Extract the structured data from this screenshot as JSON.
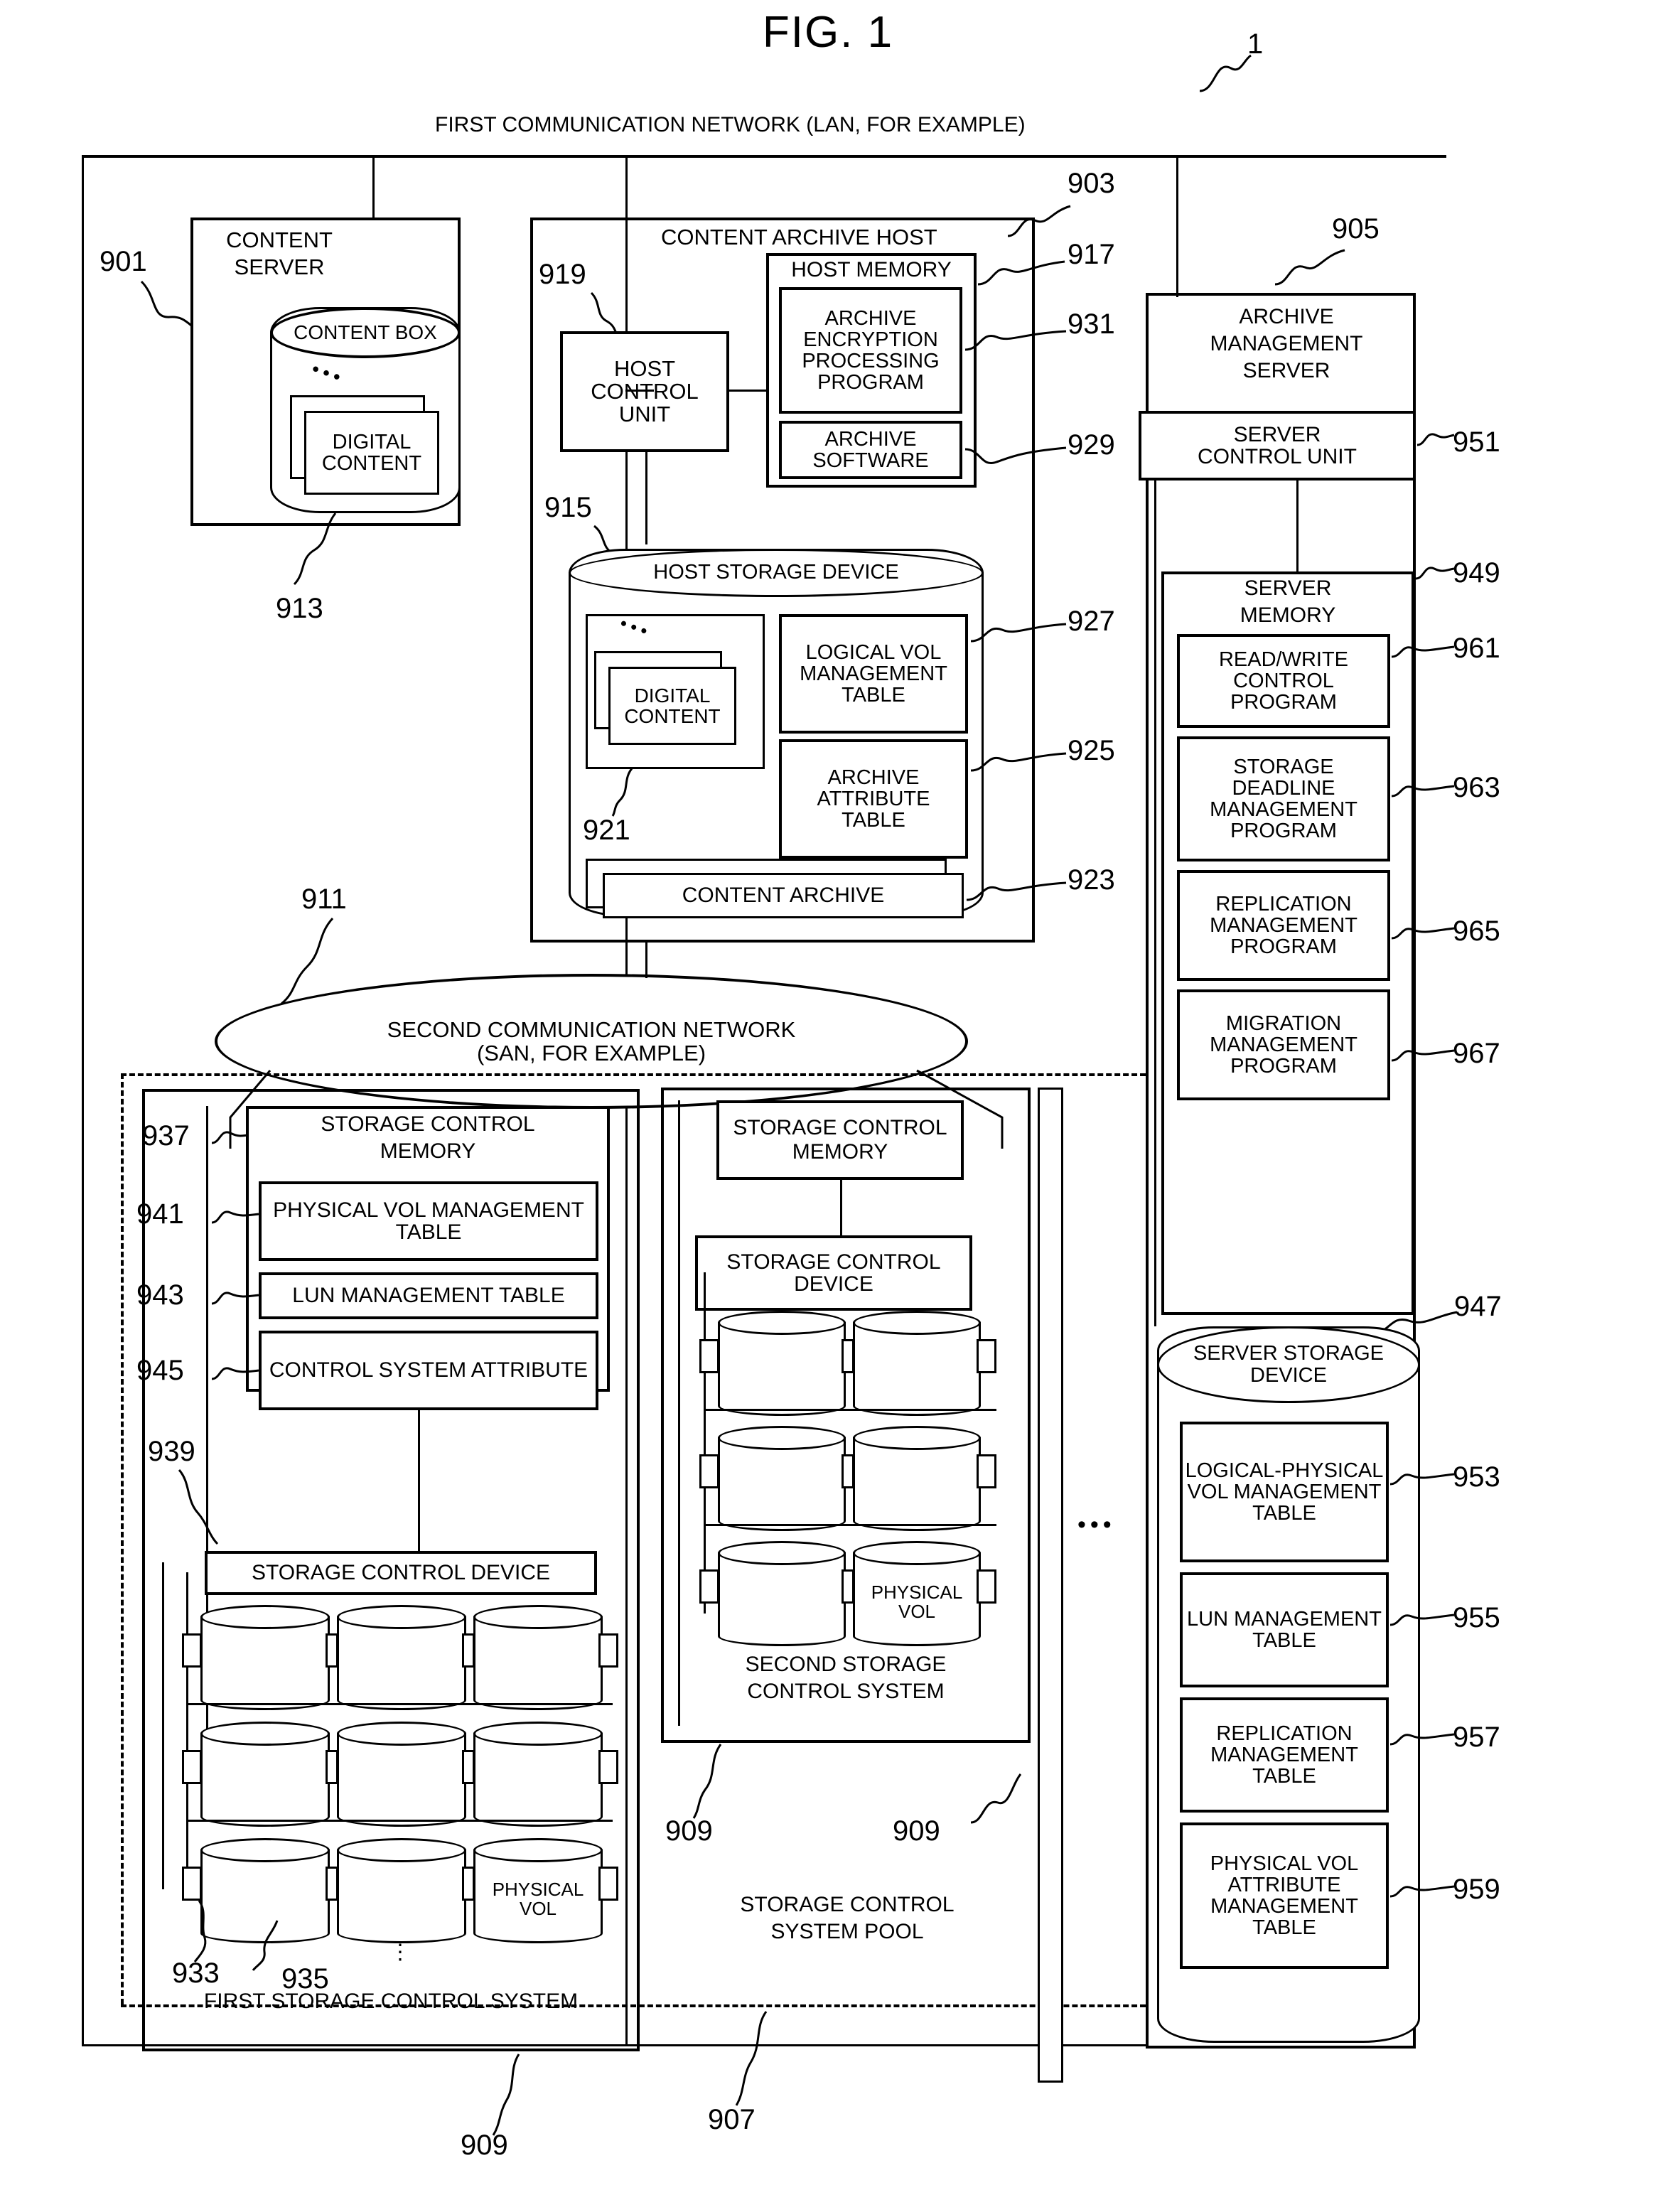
{
  "figure": {
    "title": "FIG. 1",
    "system_ref": "1"
  },
  "networks": {
    "first": {
      "label": "FIRST COMMUNICATION NETWORK (LAN, FOR EXAMPLE)"
    },
    "second": {
      "line1": "SECOND COMMUNICATION NETWORK",
      "line2": "(SAN, FOR EXAMPLE)",
      "ref": "911"
    }
  },
  "content_server": {
    "title_line1": "CONTENT",
    "title_line2": "SERVER",
    "ref": "901",
    "content_box": {
      "label": "CONTENT BOX",
      "ref": "913",
      "digital_content_line1": "DIGITAL",
      "digital_content_line2": "CONTENT"
    }
  },
  "content_archive_host": {
    "title": "CONTENT ARCHIVE HOST",
    "ref": "903",
    "host_control_unit": {
      "line1": "HOST",
      "line2": "CONTROL",
      "line3": "UNIT",
      "ref": "919"
    },
    "host_memory": {
      "title": "HOST MEMORY",
      "ref": "917",
      "items": [
        {
          "label": "ARCHIVE ENCRYPTION PROCESSING PROGRAM",
          "ref": "931"
        },
        {
          "label": "ARCHIVE SOFTWARE",
          "ref": "929"
        }
      ]
    },
    "host_storage_device": {
      "title": "HOST STORAGE DEVICE",
      "ref": "915",
      "digital_content_line1": "DIGITAL",
      "digital_content_line2": "CONTENT",
      "digital_content_ref": "921",
      "items": [
        {
          "label": "LOGICAL VOL MANAGEMENT TABLE",
          "ref": "927"
        },
        {
          "label": "ARCHIVE ATTRIBUTE TABLE",
          "ref": "925"
        },
        {
          "label": "CONTENT ARCHIVE",
          "ref": "923"
        }
      ]
    }
  },
  "archive_management_server": {
    "title_line1": "ARCHIVE",
    "title_line2": "MANAGEMENT",
    "title_line3": "SERVER",
    "ref": "905",
    "server_control_unit": {
      "line1": "SERVER",
      "line2": "CONTROL UNIT",
      "ref": "951"
    },
    "server_memory": {
      "title_line1": "SERVER",
      "title_line2": "MEMORY",
      "ref": "949",
      "items": [
        {
          "label": "READ/WRITE CONTROL PROGRAM",
          "ref": "961"
        },
        {
          "label": "STORAGE DEADLINE MANAGEMENT PROGRAM",
          "ref": "963"
        },
        {
          "label": "REPLICATION MANAGEMENT PROGRAM",
          "ref": "965"
        },
        {
          "label": "MIGRATION MANAGEMENT PROGRAM",
          "ref": "967"
        }
      ]
    },
    "server_storage_device": {
      "title_line1": "SERVER STORAGE",
      "title_line2": "DEVICE",
      "ref": "947",
      "items": [
        {
          "label": "LOGICAL-PHYSICAL VOL MANAGEMENT TABLE",
          "ref": "953"
        },
        {
          "label": "LUN MANAGEMENT TABLE",
          "ref": "955"
        },
        {
          "label": "REPLICATION MANAGEMENT TABLE",
          "ref": "957"
        },
        {
          "label": "PHYSICAL VOL ATTRIBUTE MANAGEMENT TABLE",
          "ref": "959"
        }
      ]
    }
  },
  "storage_control_system_pool": {
    "label_line1": "STORAGE CONTROL",
    "label_line2": "SYSTEM POOL",
    "ref": "907",
    "ellipsis": "•••"
  },
  "first_storage_control_system": {
    "caption": "FIRST STORAGE CONTROL SYSTEM",
    "ref": "909",
    "storage_control_memory": {
      "title_line1": "STORAGE CONTROL",
      "title_line2": "MEMORY",
      "ref": "937",
      "items": [
        {
          "label": "PHYSICAL VOL MANAGEMENT TABLE",
          "ref": "941"
        },
        {
          "label": "LUN MANAGEMENT TABLE",
          "ref": "943"
        },
        {
          "label": "CONTROL SYSTEM ATTRIBUTE",
          "ref": "945"
        }
      ]
    },
    "storage_control_device": {
      "label": "STORAGE CONTROL DEVICE",
      "ref": "939"
    },
    "physical_vol_line1": "PHYSICAL",
    "physical_vol_line2": "VOL",
    "disk_ref_left": "933",
    "disk_ref_right": "935",
    "vertical_ellipsis": "⋮"
  },
  "second_storage_control_system": {
    "caption_line1": "SECOND STORAGE",
    "caption_line2": "CONTROL SYSTEM",
    "ref": "909",
    "storage_control_memory": {
      "title_line1": "STORAGE CONTROL",
      "title_line2": "MEMORY"
    },
    "storage_control_device": {
      "line1": "STORAGE CONTROL",
      "line2": "DEVICE"
    },
    "physical_vol_line1": "PHYSICAL",
    "physical_vol_line2": "VOL"
  },
  "extra_refs": {
    "pool_right_909": "909",
    "bottom_909": "909"
  }
}
